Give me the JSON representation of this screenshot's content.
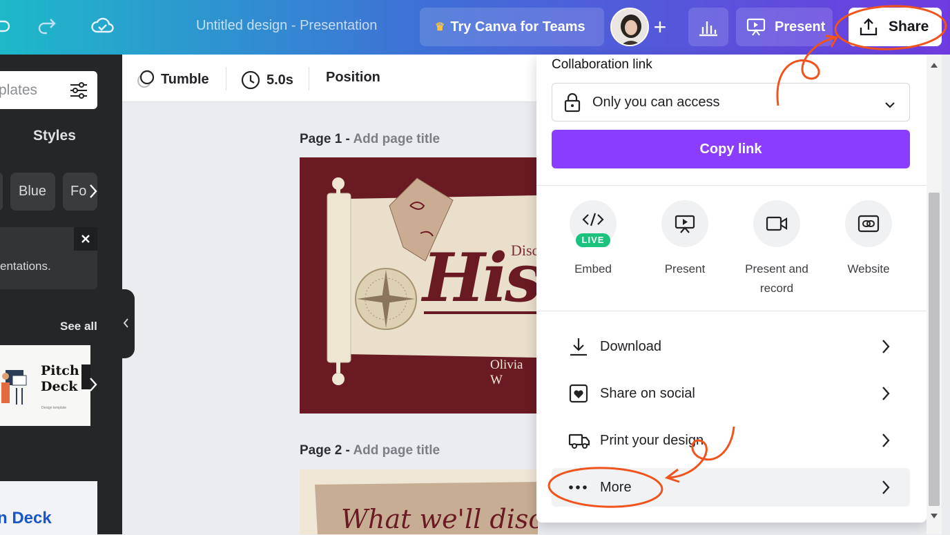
{
  "topbar": {
    "title": "Untitled design - Presentation",
    "teams_label": "Try Canva for Teams",
    "present_label": "Present",
    "share_label": "Share"
  },
  "sidebar": {
    "search_placeholder": "plates",
    "styles_heading": "Styles",
    "chips": [
      "Blue",
      "Fo"
    ],
    "tip_text": "entations.",
    "see_all": "See all",
    "template1_line1": "Pitch",
    "template1_line2": "Deck",
    "template2_text": "n Deck"
  },
  "context_bar": {
    "animation": "Tumble",
    "duration": "5.0s",
    "position": "Position"
  },
  "pages": [
    {
      "label": "Page 1 - ",
      "add_title": "Add page title",
      "preview_top": "Disc",
      "preview_main": "His",
      "preview_author": "Olivia W"
    },
    {
      "label": "Page 2 - ",
      "add_title": "Add page title",
      "preview_main": "What we'll discuss"
    }
  ],
  "share_panel": {
    "collab_label": "Collaboration link",
    "access_value": "Only you can access",
    "copy_link": "Copy link",
    "options": [
      {
        "icon": "embed-code-icon",
        "label": "Embed",
        "badge": "LIVE"
      },
      {
        "icon": "present-screen-icon",
        "label": "Present"
      },
      {
        "icon": "video-camera-icon",
        "label": "Present and record"
      },
      {
        "icon": "website-link-icon",
        "label": "Website"
      }
    ],
    "rows": [
      {
        "icon": "download-icon",
        "label": "Download"
      },
      {
        "icon": "heart-share-icon",
        "label": "Share on social"
      },
      {
        "icon": "truck-icon",
        "label": "Print your design"
      },
      {
        "icon": "more-dots-icon",
        "label": "More"
      }
    ]
  },
  "colors": {
    "brand_purple": "#8b3dff",
    "annotation_orange": "#f0531c",
    "live_green": "#19c37d"
  }
}
